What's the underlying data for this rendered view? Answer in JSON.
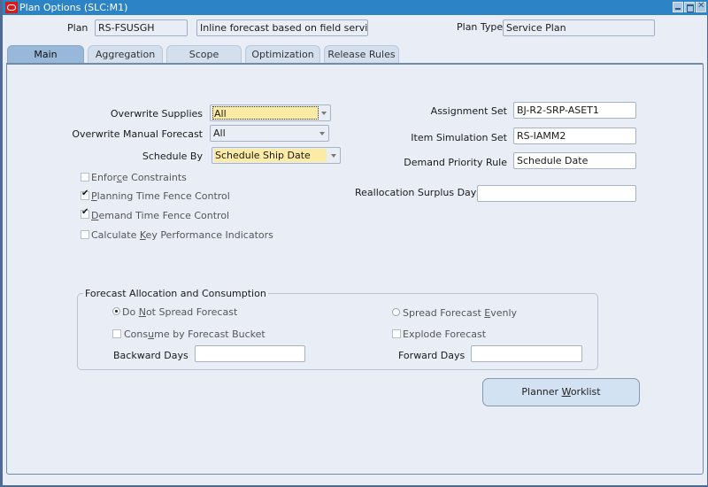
{
  "window": {
    "title": "Plan Options (SLC:M1)",
    "controls": {
      "minimize": "minimize",
      "maximize": "maximize",
      "close": "close"
    }
  },
  "header": {
    "plan_label": "Plan",
    "plan_value": "RS-FSUSGH",
    "plan_description": "Inline forecast based on field service",
    "plan_type_label": "Plan Type",
    "plan_type_value": "Service Plan"
  },
  "tabs": [
    {
      "label": "Main",
      "active": true
    },
    {
      "label": "Aggregation",
      "active": false
    },
    {
      "label": "Scope",
      "active": false
    },
    {
      "label": "Optimization",
      "active": false
    },
    {
      "label": "Release Rules",
      "active": false
    }
  ],
  "main": {
    "overwrite_supplies": {
      "label": "Overwrite Supplies",
      "value": "All"
    },
    "overwrite_manual_forecast": {
      "label": "Overwrite Manual Forecast",
      "value": "All"
    },
    "schedule_by": {
      "label": "Schedule By",
      "value": "Schedule Ship Date"
    },
    "checkboxes": [
      {
        "pre": "Enfor",
        "mnemonic": "c",
        "post": "e Constraints",
        "checked": false,
        "enabled": false
      },
      {
        "pre": "",
        "mnemonic": "P",
        "post": "lanning Time Fence Control",
        "checked": true,
        "enabled": true
      },
      {
        "pre": "",
        "mnemonic": "D",
        "post": "emand Time Fence Control",
        "checked": true,
        "enabled": true
      },
      {
        "pre": "Calculate ",
        "mnemonic": "K",
        "post": "ey Performance Indicators",
        "checked": false,
        "enabled": false
      }
    ],
    "assignment_set": {
      "label": "Assignment Set",
      "value": "BJ-R2-SRP-ASET1"
    },
    "item_simulation_set": {
      "label": "Item Simulation Set",
      "value": "RS-IAMM2"
    },
    "demand_priority_rule": {
      "label": "Demand Priority Rule",
      "value": "Schedule Date"
    },
    "reallocation_surplus_days": {
      "label": "Reallocation Surplus Days",
      "value": ""
    }
  },
  "forecast_group": {
    "title": "Forecast Allocation and Consumption",
    "do_not_spread": {
      "pre": "Do ",
      "mnemonic": "N",
      "post": "ot Spread Forecast",
      "selected": true
    },
    "spread_evenly": {
      "pre": "Spread Forecast ",
      "mnemonic": "E",
      "post": "venly",
      "selected": false
    },
    "consume_by_bucket": {
      "pre": "Cons",
      "mnemonic": "u",
      "post": "me by Forecast Bucket",
      "checked": false
    },
    "explode_forecast": {
      "label": "Explode Forecast",
      "checked": false
    },
    "backward_days": {
      "label": "Backward Days",
      "value": ""
    },
    "forward_days": {
      "label": "Forward Days",
      "value": ""
    }
  },
  "buttons": {
    "planner_worklist": {
      "pre": "Planner ",
      "mnemonic": "W",
      "post": "orklist"
    }
  }
}
